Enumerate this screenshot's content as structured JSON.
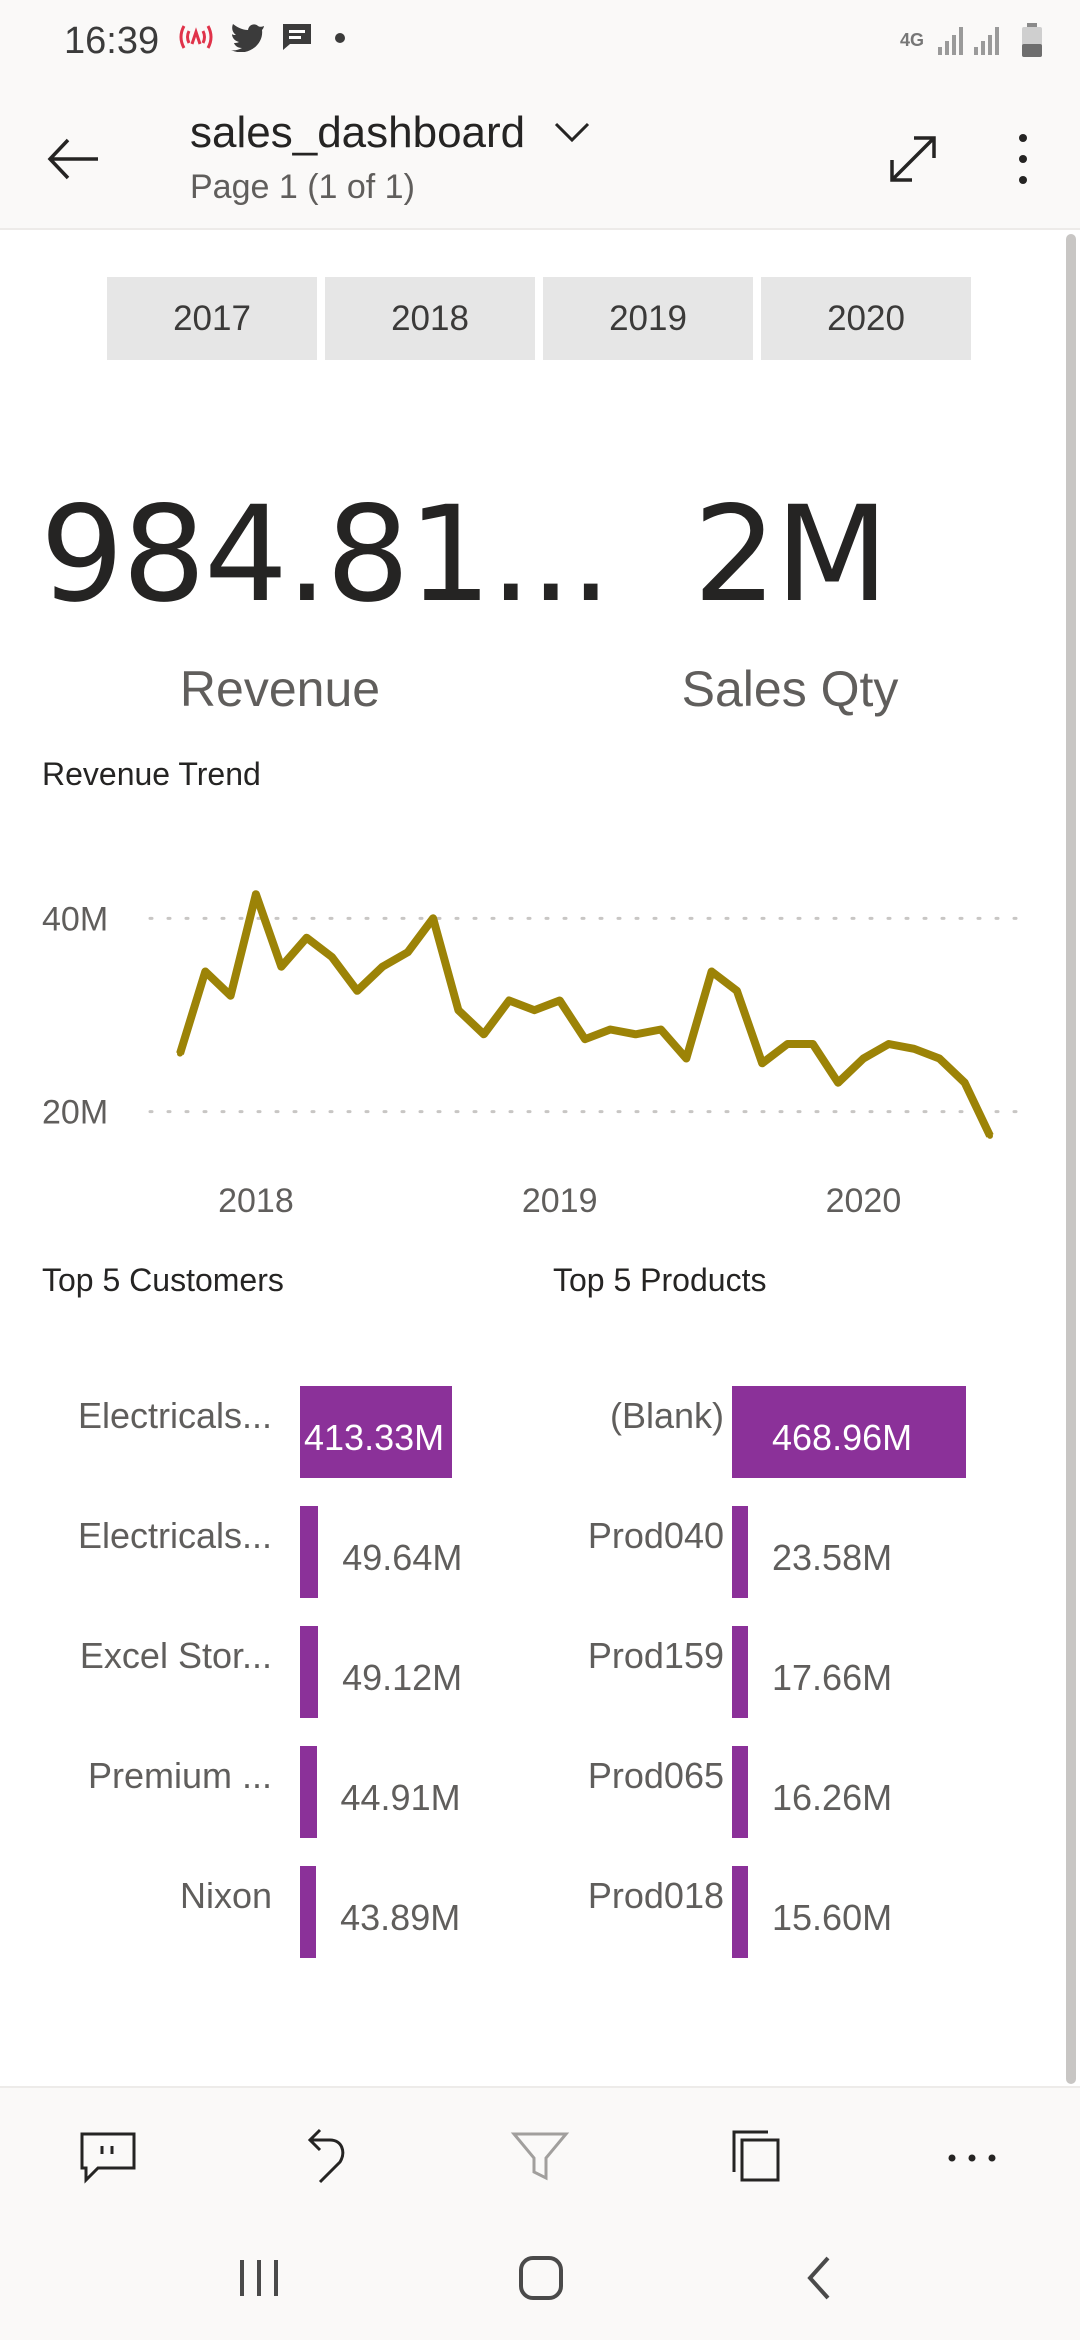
{
  "status_bar": {
    "time": "16:39",
    "network": "4G",
    "icons": [
      "hotspot-icon",
      "twitter-icon",
      "message-icon",
      "dot-icon",
      "signal-icon",
      "battery-icon"
    ]
  },
  "header": {
    "title": "sales_dashboard",
    "subtitle": "Page 1 (1 of 1)"
  },
  "slicer": {
    "years": [
      "2017",
      "2018",
      "2019",
      "2020"
    ]
  },
  "kpis": {
    "revenue": {
      "value": "984.81...",
      "label": "Revenue"
    },
    "sales_qty": {
      "value": "2M",
      "label": "Sales Qty"
    }
  },
  "revenue_trend": {
    "title": "Revenue Trend"
  },
  "top_customers": {
    "title": "Top 5 Customers"
  },
  "top_products": {
    "title": "Top 5 Products"
  },
  "colors": {
    "accent_bar": "#8b3199",
    "trend_line": "#9c8307",
    "gridline": "#c8c6c4"
  },
  "chart_data": [
    {
      "type": "line",
      "title": "Revenue Trend",
      "xlabel": "",
      "ylabel": "",
      "x_ticks": [
        "2018",
        "2019",
        "2020"
      ],
      "y_ticks": [
        "20M",
        "40M"
      ],
      "ylim": [
        15,
        45
      ],
      "grid": true,
      "x": [
        1,
        2,
        3,
        4,
        5,
        6,
        7,
        8,
        9,
        10,
        11,
        12,
        13,
        14,
        15,
        16,
        17,
        18,
        19,
        20,
        21,
        22,
        23,
        24,
        25,
        26,
        27,
        28,
        29,
        30,
        31,
        32,
        33
      ],
      "tick_positions": [
        4,
        16,
        28
      ],
      "series": [
        {
          "values": [
            26,
            34.5,
            32,
            42.5,
            35,
            38,
            36,
            32.5,
            35,
            36.5,
            40,
            30.5,
            28,
            31.5,
            30.5,
            31.5,
            27.5,
            28.5,
            28,
            28.5,
            25.5,
            34.5,
            32.5,
            25,
            27,
            27,
            23,
            25.5,
            27,
            26.5,
            25.5,
            23,
            17.5
          ]
        }
      ]
    },
    {
      "type": "bar",
      "title": "Top 5 Customers",
      "categories": [
        "Electricals...",
        "Electricals...",
        "Excel Stor...",
        "Premium ...",
        "Nixon"
      ],
      "values": [
        413.33,
        49.64,
        49.12,
        44.91,
        43.89
      ],
      "value_labels": [
        "413.33M",
        "49.64M",
        "49.12M",
        "44.91M",
        "43.89M"
      ]
    },
    {
      "type": "bar",
      "title": "Top 5 Products",
      "categories": [
        "(Blank)",
        "Prod040",
        "Prod159",
        "Prod065",
        "Prod018"
      ],
      "values": [
        468.96,
        23.58,
        17.66,
        16.26,
        15.6
      ],
      "value_labels": [
        "468.96M",
        "23.58M",
        "17.66M",
        "16.26M",
        "15.60M"
      ]
    }
  ],
  "bottom_toolbar": {
    "buttons": [
      "comment-icon",
      "undo-icon",
      "filter-icon",
      "pages-icon",
      "more-horizontal-icon"
    ]
  }
}
